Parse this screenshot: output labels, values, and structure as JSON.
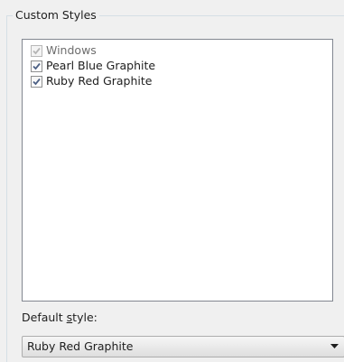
{
  "groupbox": {
    "title": "Custom Styles"
  },
  "styles_list": {
    "items": [
      {
        "label": "Windows",
        "checked": true,
        "enabled": false
      },
      {
        "label": "Pearl Blue Graphite",
        "checked": true,
        "enabled": true
      },
      {
        "label": "Ruby Red Graphite",
        "checked": true,
        "enabled": true
      }
    ]
  },
  "default_style": {
    "label_prefix": "Default ",
    "label_accel": "s",
    "label_suffix": "tyle:",
    "selected_value": "Ruby Red Graphite"
  },
  "icons": {
    "checkmark": "checkmark-icon",
    "dropdown": "chevron-down-icon"
  },
  "colors": {
    "window_bg": "#f0f0f0",
    "list_bg": "#ffffff",
    "check_enabled": "#4d6185",
    "check_disabled": "#b5b5b5"
  }
}
